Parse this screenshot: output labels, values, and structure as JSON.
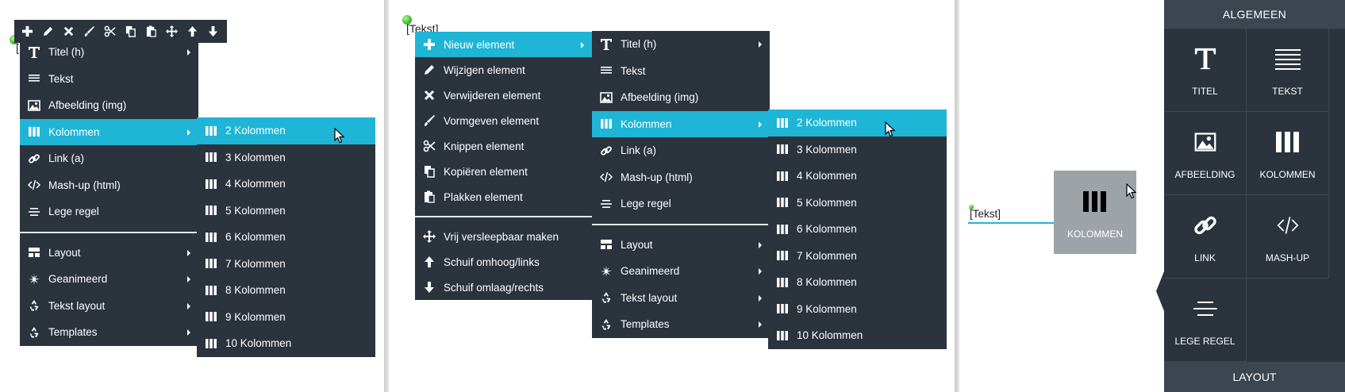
{
  "colors": {
    "menu_bg": "#2b333d",
    "accent": "#1fb5d6",
    "sidebar_header": "#3c4650",
    "drag_ghost": "#9ea3a8"
  },
  "panel1": {
    "toolbar": {
      "icons": [
        "plus-icon",
        "pencil-icon",
        "close-icon",
        "brush-icon",
        "scissors-icon",
        "copy-icon",
        "paste-icon",
        "move-icon",
        "arrow-up-icon",
        "arrow-down-icon"
      ]
    },
    "placeholder_text": "[",
    "menu": {
      "items": [
        {
          "label": "Titel (h)",
          "icon": "title-icon"
        },
        {
          "label": "Tekst",
          "icon": "lines-icon"
        },
        {
          "label": "Afbeelding (img)",
          "icon": "image-icon"
        },
        {
          "label": "Kolommen",
          "icon": "columns-icon"
        },
        {
          "label": "Link (a)",
          "icon": "link-icon"
        },
        {
          "label": "Mash-up (html)",
          "icon": "code-icon"
        },
        {
          "label": "Lege regel",
          "icon": "empty-line-icon"
        },
        {
          "label": "Layout",
          "icon": "layout-icon"
        },
        {
          "label": "Geanimeerd",
          "icon": "animated-icon"
        },
        {
          "label": "Tekst layout",
          "icon": "recycle-icon"
        },
        {
          "label": "Templates",
          "icon": "recycle-icon"
        }
      ]
    },
    "submenu": {
      "items": [
        "2  Kolommen",
        "3  Kolommen",
        "4  Kolommen",
        "5  Kolommen",
        "6  Kolommen",
        "7  Kolommen",
        "8  Kolommen",
        "9  Kolommen",
        "10  Kolommen"
      ]
    }
  },
  "panel2": {
    "placeholder_text": "[Tekst]",
    "context_menu": {
      "items": [
        {
          "label": "Nieuw element",
          "icon": "plus-icon"
        },
        {
          "label": "Wijzigen element",
          "icon": "pencil-icon"
        },
        {
          "label": "Verwijderen element",
          "icon": "close-icon"
        },
        {
          "label": "Vormgeven element",
          "icon": "brush-icon"
        },
        {
          "label": "Knippen element",
          "icon": "scissors-icon"
        },
        {
          "label": "Kopiëren element",
          "icon": "copy-icon"
        },
        {
          "label": "Plakken element",
          "icon": "paste-icon"
        },
        {
          "label": "Vrij versleepbaar maken",
          "icon": "move-icon"
        },
        {
          "label": "Schuif omhoog/links",
          "icon": "arrow-up-icon"
        },
        {
          "label": "Schuif omlaag/rechts",
          "icon": "arrow-down-icon"
        }
      ]
    },
    "element_menu": {
      "items": [
        {
          "label": "Titel (h)",
          "icon": "title-icon"
        },
        {
          "label": "Tekst",
          "icon": "lines-icon"
        },
        {
          "label": "Afbeelding (img)",
          "icon": "image-icon"
        },
        {
          "label": "Kolommen",
          "icon": "columns-icon"
        },
        {
          "label": "Link (a)",
          "icon": "link-icon"
        },
        {
          "label": "Mash-up (html)",
          "icon": "code-icon"
        },
        {
          "label": "Lege regel",
          "icon": "empty-line-icon"
        },
        {
          "label": "Layout",
          "icon": "layout-icon"
        },
        {
          "label": "Geanimeerd",
          "icon": "animated-icon"
        },
        {
          "label": "Tekst layout",
          "icon": "recycle-icon"
        },
        {
          "label": "Templates",
          "icon": "recycle-icon"
        }
      ]
    },
    "columns_menu": {
      "items": [
        "2  Kolommen",
        "3  Kolommen",
        "4  Kolommen",
        "5  Kolommen",
        "6  Kolommen",
        "7  Kolommen",
        "8  Kolommen",
        "9  Kolommen",
        "10  Kolommen"
      ]
    }
  },
  "panel3": {
    "placeholder_text": "[Tekst]",
    "drag_ghost_label": "KOLOMMEN",
    "sidebar": {
      "header": "ALGEMEEN",
      "tiles": [
        {
          "label": "TITEL",
          "icon": "title-icon"
        },
        {
          "label": "TEKST",
          "icon": "lines-icon"
        },
        {
          "label": "AFBEELDING",
          "icon": "image-icon"
        },
        {
          "label": "KOLOMMEN",
          "icon": "columns-icon"
        },
        {
          "label": "LINK",
          "icon": "link-icon"
        },
        {
          "label": "MASH-UP",
          "icon": "code-icon"
        },
        {
          "label": "LEGE REGEL",
          "icon": "empty-line-icon"
        }
      ],
      "footer": "LAYOUT"
    }
  }
}
